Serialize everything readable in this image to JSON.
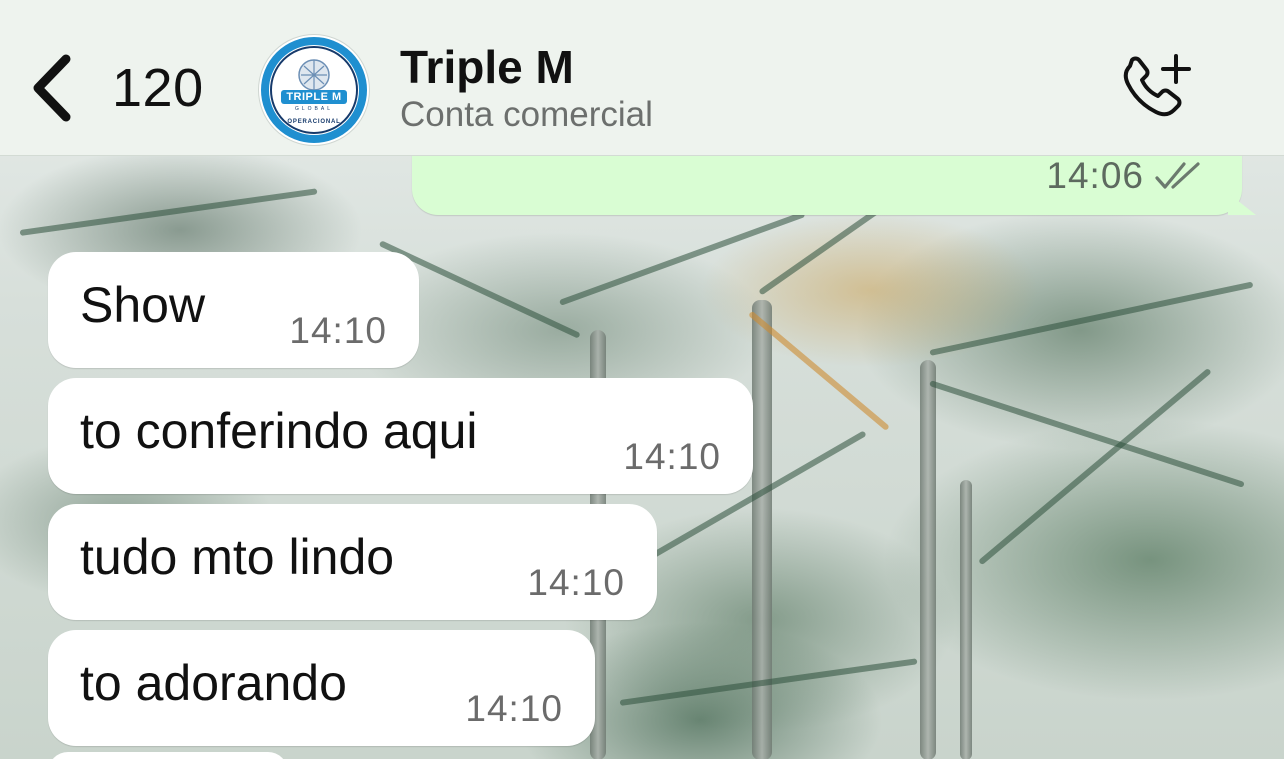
{
  "header": {
    "unread_count": "120",
    "contact_name": "Triple M",
    "contact_subtitle": "Conta comercial",
    "avatar_logo_text": "TRIPLE M",
    "avatar_ring_text": "OPERACIONAL",
    "avatar_small_text": "GLOBAL"
  },
  "icons": {
    "back": "chevron-left-icon",
    "call": "phone-plus-icon",
    "read_receipt": "double-check-icon"
  },
  "colors": {
    "header_bg": "#eef3ee",
    "sent_bubble": "#d9fdd3",
    "received_bubble": "#ffffff",
    "logo_blue": "#1f8fd0"
  },
  "messages": {
    "sent": {
      "time": "14:06",
      "status": "read"
    },
    "received": [
      {
        "text": "Show",
        "time": "14:10"
      },
      {
        "text": "to conferindo aqui",
        "time": "14:10"
      },
      {
        "text": "tudo mto lindo",
        "time": "14:10"
      },
      {
        "text": "to adorando",
        "time": "14:10"
      }
    ]
  }
}
